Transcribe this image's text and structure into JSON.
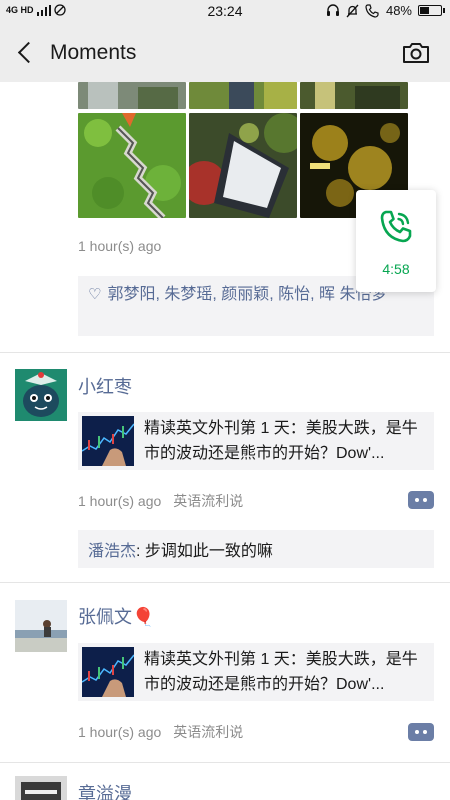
{
  "status_bar": {
    "network": "4G HD",
    "time": "23:24",
    "battery": "48%",
    "battery_level": 0.48
  },
  "header": {
    "title": "Moments",
    "back_icon": "chevron-left-icon",
    "camera_icon": "camera-icon"
  },
  "posts": [
    {
      "timestamp": "1 hour(s) ago",
      "likes": "郭梦阳, 朱梦瑶, 颜丽颖, 陈怡, 晖 朱怡梦"
    },
    {
      "author": "小红枣",
      "link_title": "精读英文外刊第 1 天：美股大跌，是牛市的波动还是熊市的开始？Dow'...",
      "timestamp": "1 hour(s) ago",
      "source": "英语流利说",
      "comment_author": "潘浩杰",
      "comment_text": ": 步调如此一致的嘛"
    },
    {
      "author": "张佩文🎈",
      "link_title": "精读英文外刊第 1 天：美股大跌，是牛市的波动还是熊市的开始？Dow'...",
      "timestamp": "1 hour(s) ago",
      "source": "英语流利说"
    },
    {
      "author": "章溢漫"
    }
  ],
  "call_widget": {
    "duration": "4:58",
    "icon": "phone-icon",
    "color": "#07a651"
  },
  "colors": {
    "link_blue": "#576b95",
    "header_bg": "#ededed",
    "card_bg": "#f3f3f5"
  }
}
